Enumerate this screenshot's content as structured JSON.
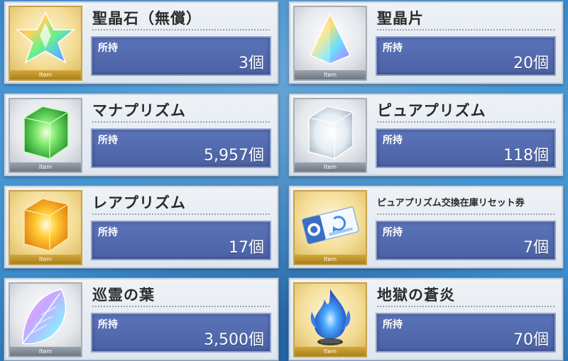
{
  "common": {
    "tag_label": "Item",
    "held_label": "所持"
  },
  "items": [
    {
      "name": "聖晶石（無償）",
      "count": "3個",
      "icon": "saint-quartz-icon",
      "frame": "gold"
    },
    {
      "name": "聖晶片",
      "count": "20個",
      "icon": "quartz-fragment-icon",
      "frame": "silver"
    },
    {
      "name": "マナプリズム",
      "count": "5,957個",
      "icon": "mana-prism-icon",
      "frame": "silver"
    },
    {
      "name": "ピュアプリズム",
      "count": "118個",
      "icon": "pure-prism-icon",
      "frame": "silver"
    },
    {
      "name": "レアプリズム",
      "count": "17個",
      "icon": "rare-prism-icon",
      "frame": "gold"
    },
    {
      "name": "ピュアプリズム交換在庫リセット券",
      "count": "7個",
      "icon": "reset-ticket-icon",
      "frame": "gold"
    },
    {
      "name": "巡霊の葉",
      "count": "3,500個",
      "icon": "spirit-leaf-icon",
      "frame": "silver"
    },
    {
      "name": "地獄の蒼炎",
      "count": "70個",
      "icon": "blue-flame-icon",
      "frame": "gold"
    }
  ],
  "colors": {
    "background": "#3f8fce",
    "panel": "#4f66aa",
    "card": "#e6ebf1",
    "gold_frame": "#c8a24a",
    "silver_frame": "#a7aeb8"
  }
}
